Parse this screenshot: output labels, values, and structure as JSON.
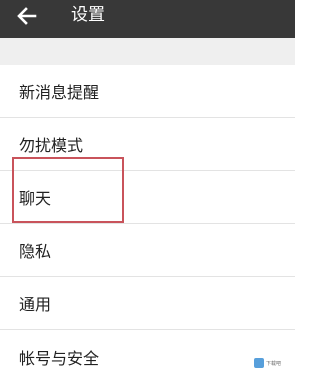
{
  "header": {
    "title": "设置",
    "back_icon": "arrow-left-icon",
    "background": "#383838"
  },
  "settings": {
    "items": [
      {
        "label": "新消息提醒"
      },
      {
        "label": "勿扰模式"
      },
      {
        "label": "聊天",
        "highlighted": true
      },
      {
        "label": "隐私"
      },
      {
        "label": "通用"
      },
      {
        "label": "帐号与安全"
      }
    ]
  },
  "highlight_color": "#c9535b",
  "watermark": {
    "text": "下载吧"
  }
}
